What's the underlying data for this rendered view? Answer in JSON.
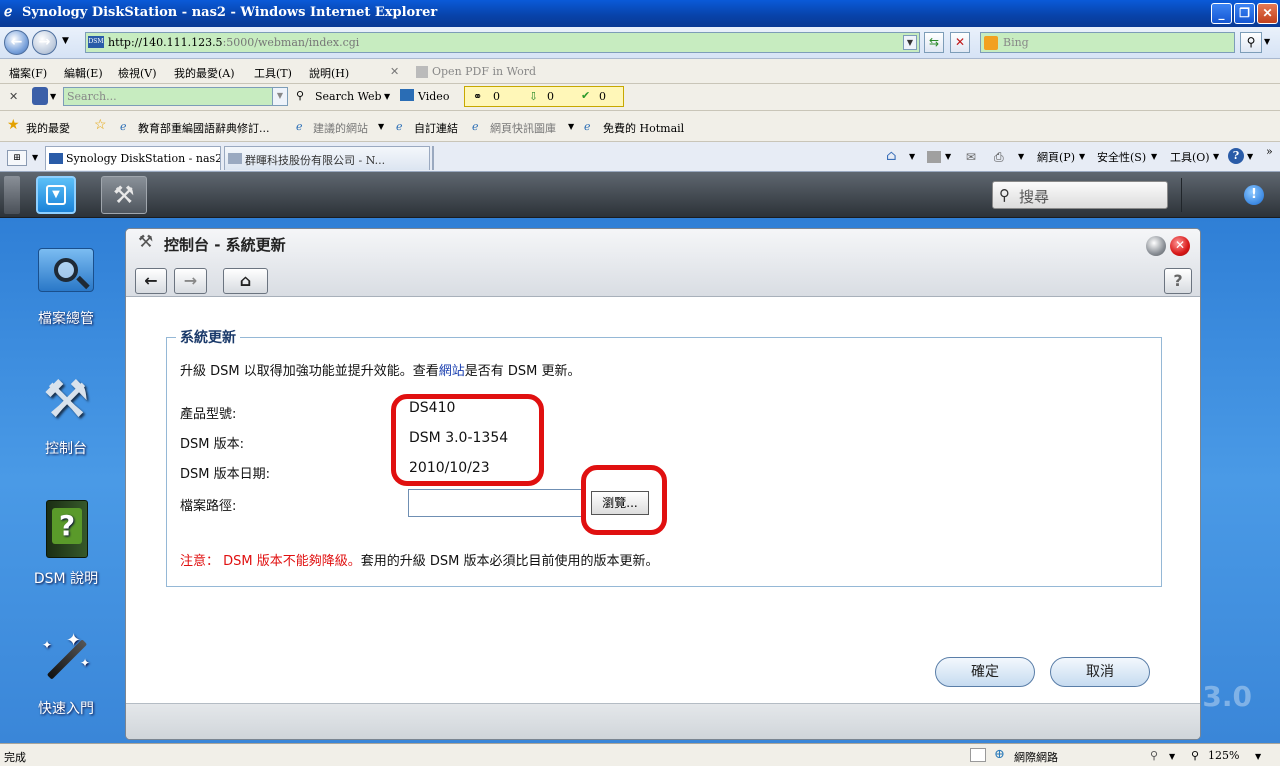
{
  "browser": {
    "window_title": "Synology DiskStation - nas2 - Windows Internet Explorer",
    "url_domain": "http://140.111.123.5",
    "url_rest": ":5000/webman/index.cgi",
    "search_engine_placeholder": "Bing",
    "menu": [
      "檔案(F)",
      "編輯(E)",
      "檢視(V)",
      "我的最愛(A)",
      "工具(T)",
      "說明(H)"
    ],
    "open_pdf_label": "Open PDF in Word",
    "toolbar_search_placeholder": "Search...",
    "search_web_label": "Search Web",
    "video_label": "Video",
    "counters": [
      "0",
      "0",
      "0"
    ],
    "favorites_label": "我的最愛",
    "favorites": [
      "教育部重編國語辭典修訂...",
      "建議的網站",
      "自訂連結",
      "網頁快訊圖庫",
      "免費的 Hotmail"
    ],
    "tabs": [
      {
        "label": "Synology DiskStation - nas2",
        "active": true
      },
      {
        "label": "群暉科技股份有限公司 - N...",
        "active": false
      }
    ],
    "cmd": [
      "網頁(P)",
      "安全性(S)",
      "工具(O)"
    ],
    "status_left": "完成",
    "status_zone": "網際網路",
    "zoom": "125%"
  },
  "dsm": {
    "search_placeholder": "搜尋",
    "desktop_icons": [
      {
        "label": "檔案總管",
        "icon": "file-browser-icon"
      },
      {
        "label": "控制台",
        "icon": "control-panel-icon"
      },
      {
        "label": "DSM 說明",
        "icon": "help-book-icon"
      },
      {
        "label": "快速入門",
        "icon": "magic-wand-icon"
      }
    ],
    "watermark": "3.0"
  },
  "control_panel": {
    "title": "控制台 - 系統更新",
    "section_title": "系統更新",
    "intro_prefix": "升級 DSM 以取得加強功能並提升效能。查看",
    "intro_link": "網站",
    "intro_suffix": "是否有 DSM 更新。",
    "fields": {
      "model_label": "產品型號:",
      "model_value": "DS410",
      "version_label": "DSM 版本:",
      "version_value": "DSM 3.0-1354",
      "date_label": "DSM 版本日期:",
      "date_value": "2010/10/23",
      "path_label": "檔案路徑:",
      "path_value": ""
    },
    "browse_label": "瀏覽...",
    "note_red": "注意： DSM 版本不能夠降級。",
    "note_black": "套用的升級 DSM 版本必須比目前使用的版本更新。",
    "ok_label": "確定",
    "cancel_label": "取消"
  },
  "colors": {
    "annotation_red": "#e01010",
    "desktop_blue": "#3a86d8",
    "link_blue": "#1a3fb0"
  }
}
